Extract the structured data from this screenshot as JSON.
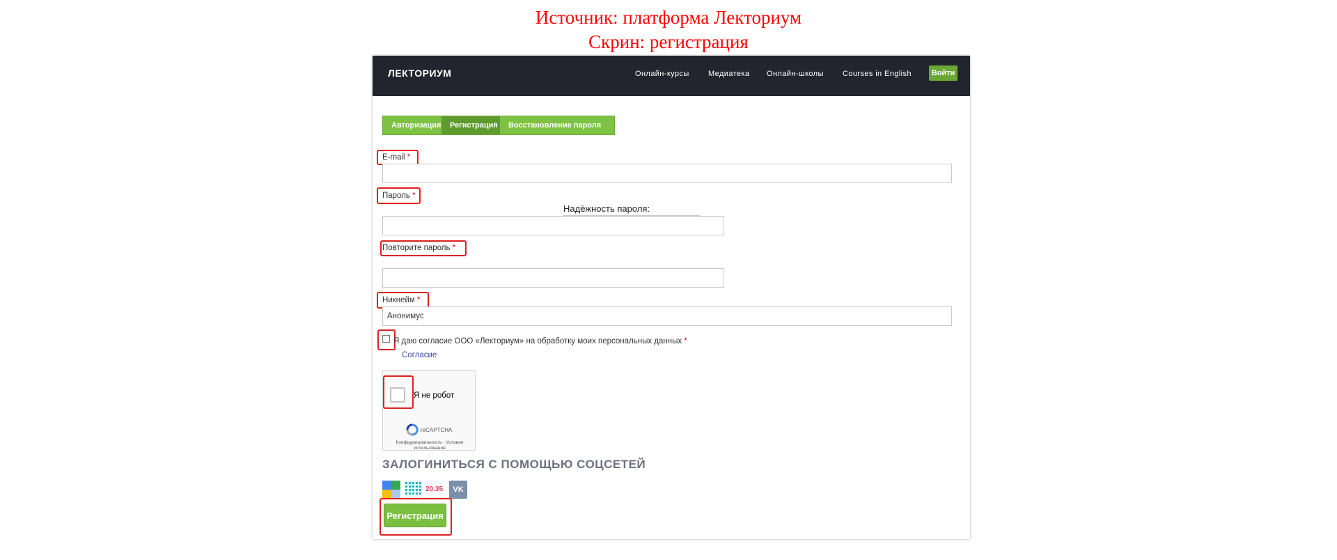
{
  "annotation": {
    "line1": "Источник: платформа Лекториум",
    "line2": "Скрин: регистрация",
    "color": "#ff0000"
  },
  "header": {
    "logo": "ЛЕКТОРИУМ",
    "nav": [
      "Онлайн-курсы",
      "Медиатека",
      "Онлайн-школы",
      "Courses in English"
    ],
    "login": "Войти"
  },
  "tabs": {
    "login": "Авторизация",
    "register": "Регистрация",
    "recover": "Восстановление пароля",
    "active": "register"
  },
  "form": {
    "email_label": "E-mail",
    "password_label": "Пароль",
    "strength_label": "Надёжность пароля:",
    "repeat_label": "Повторите пароль",
    "nickname_label": "Никнейм",
    "nickname_value": "Анонимус",
    "required_mark": "*",
    "consent_text": "Я даю согласие ООО «Лекториум» на обработку моих персональных данных",
    "consent_link": "Согласие"
  },
  "captcha": {
    "label": "Я не робот",
    "brand": "reCAPTCHA",
    "privacy": "Конфиденциальность - Условия использования"
  },
  "social": {
    "heading": "ЗАЛОГИНИТЬСЯ С ПОМОЩЬЮ СОЦСЕТЕЙ",
    "items": [
      "google-icon",
      "leader-id-icon",
      "2035-icon",
      "vk-icon"
    ],
    "text_2035": "20.35",
    "vk_text": "VK"
  },
  "submit": "Регистрация",
  "colors": {
    "accent": "#7ec244",
    "header_bg": "#23252e",
    "highlight": "#e02020"
  }
}
